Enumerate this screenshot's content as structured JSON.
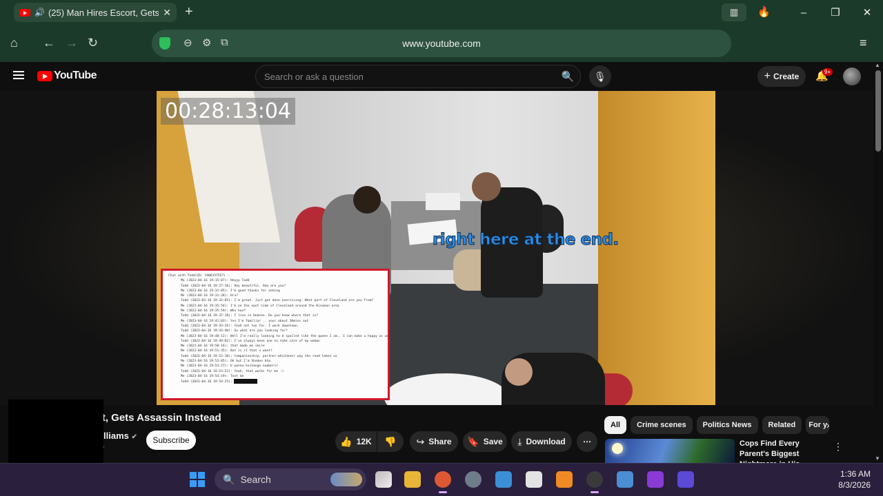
{
  "browser": {
    "tab_title": "(25) Man Hires Escort, Gets Assassin Instead",
    "tab_close": "✕",
    "new_tab": "+",
    "url": "www.youtube.com",
    "window_minimize": "–",
    "window_restore": "❐",
    "window_close": "✕"
  },
  "youtube": {
    "logo_text": "YouTube",
    "search_placeholder": "Search or ask a question",
    "create_label": "Create",
    "notification_count": "9+"
  },
  "video": {
    "timecode": "00:28:13:04",
    "caption": "right here at the end.",
    "chat_lines": [
      "Chat with Todd(ID: 1906157557) :",
      "Me (2023-04-16 19:15:07): Heyyy Todd",
      "Todd (2023-04-16 19:27:16): Hey beautiful. How are you?",
      "Me (2023-04-16 19:31:05): I'm good thanks for asking",
      "Me (2023-04-16 19:31:28): Hru?",
      "Todd (2023-04-16 19:32:05): I'm great. Just got done exercising. What part of Cleveland are you from?",
      "Me (2023-04-16 19:35:54): I'm on the east side of Cleveland around the Kinsman area",
      "Me (2023-04-16 19:35:59): Who hun?",
      "Todd (2023-04-16 19:37:18): I live in Hudson. Do you know where that is?",
      "Me (2023-04-16 19:41:03): Yes I'm familiar .. your about 30mins out",
      "Todd (2023-04-16 19:43:35): Yeah not too far. I work downtown.",
      "Todd (2023-04-16 19:43:40): So what are you looking for?",
      "Me (2023-04-16 19:48:12): Well I'm really looking to b spoiled like the queen I am.. I can make u happy as well",
      "Todd (2023-04-16 19:49:02): I've always been one to take care of my woman",
      "Me (2023-04-16 19:50:16): that made me smile",
      "Me (2023-04-16 19:51:35): But is it that u want?",
      "Todd (2023-04-16 19:52:10): Companionship, partner-whichever way the road takes us",
      "Me (2023-04-16 19:53:05): Ok but I'm Shaden btw",
      "Me (2023-04-16 19:53:27): U wanna exchange numbers?",
      "Todd (2023-04-16 19:53:52): Yeah, that works for me :)",
      "Me (2023-04-16 19:54:19): Text me",
      "Todd (2023-04-16 19:54:25):"
    ],
    "title": "rt, Gets Assassin Instead",
    "channel": "lliams",
    "verified": "✔",
    "subscribers": "s",
    "subscribe_label": "Subscribe",
    "likes": "12K",
    "share_label": "Share",
    "save_label": "Save",
    "download_label": "Download",
    "more_label": "⋯"
  },
  "related": {
    "chips": [
      "All",
      "Crime scenes",
      "Politics News",
      "Related",
      "For y"
    ],
    "first_title": "Cops Find Every Parent's Biggest Nightmare in His ..."
  },
  "taskbar": {
    "search_label": "Search",
    "time": "1:36 AM",
    "date": "8/3/2026"
  },
  "colors": {
    "browser_chrome": "#1c3a2a",
    "youtube_red": "#ff0000",
    "caption_blue": "#2e8de8",
    "chat_border": "#d0172a",
    "taskbar": "#2a1f3c"
  }
}
